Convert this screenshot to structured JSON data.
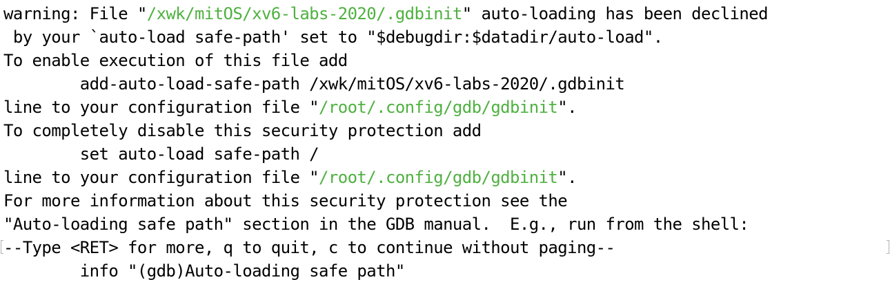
{
  "lines": [
    {
      "parts": [
        {
          "text": "warning: File \""
        },
        {
          "text": "/xwk/mitOS/xv6-labs-2020/.gdbinit",
          "path": true
        },
        {
          "text": "\" auto-loading has been declined"
        }
      ]
    },
    {
      "parts": [
        {
          "text": " by your `auto-load safe-path' set to \"$debugdir:$datadir/auto-load\"."
        }
      ]
    },
    {
      "parts": [
        {
          "text": "To enable execution of this file add"
        }
      ]
    },
    {
      "parts": [
        {
          "text": "        add-auto-load-safe-path /xwk/mitOS/xv6-labs-2020/.gdbinit"
        }
      ]
    },
    {
      "parts": [
        {
          "text": "line to your configuration file \""
        },
        {
          "text": "/root/.config/gdb/gdbinit",
          "path": true
        },
        {
          "text": "\"."
        }
      ]
    },
    {
      "parts": [
        {
          "text": "To completely disable this security protection add"
        }
      ]
    },
    {
      "parts": [
        {
          "text": "        set auto-load safe-path /"
        }
      ]
    },
    {
      "parts": [
        {
          "text": "line to your configuration file \""
        },
        {
          "text": "/root/.config/gdb/gdbinit",
          "path": true
        },
        {
          "text": "\"."
        }
      ]
    },
    {
      "parts": [
        {
          "text": "For more information about this security protection see the"
        }
      ]
    },
    {
      "parts": [
        {
          "text": "\"Auto-loading safe path\" section in the GDB manual.  E.g., run from the shell:"
        }
      ]
    },
    {
      "parts": [
        {
          "text": "--Type <RET> for more, q to quit, c to continue without paging--"
        }
      ]
    },
    {
      "parts": [
        {
          "text": "        info \"(gdb)Auto-loading safe path\""
        }
      ]
    }
  ],
  "colors": {
    "text": "#000000",
    "path": "#4fb140",
    "background": "#ffffff"
  }
}
